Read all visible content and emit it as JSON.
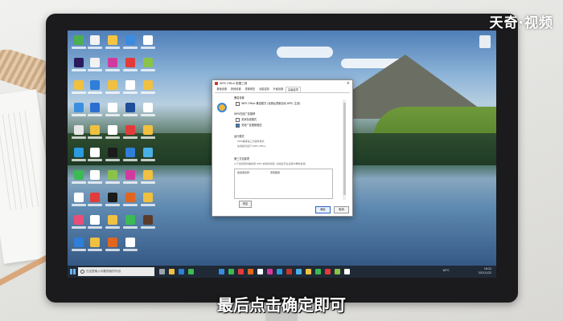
{
  "watermark": "天奇·视频",
  "subtitle": "最后点击确定即可",
  "dialog": {
    "title": "WPS Office 配置工具",
    "close_icon": "close-icon",
    "tabs": [
      "基础设置",
      "其他设置",
      "重置修复",
      "功能定制",
      "升级设置",
      "高级选项"
    ],
    "active_tab": "高级选项",
    "sections": {
      "compat_title": "兼容设置",
      "compat_option": "WPS Office 兼容模式 (设置后重新启动 WPS, 生效)",
      "wps_title": "WPS在线广告推荐",
      "wps_opt1": "关闭在线模式",
      "wps_opt2": "关闭广告更新推送",
      "office_title": "运行模式",
      "office_opt1": "WPS兼容第三方插件模式",
      "office_opt2": "在线模式运行 WPS Office",
      "plugin_title": "第三方加载项",
      "plugin_desc": "以下加载项将被禁用 WPS 启动时加载, 勾选后可在设置中重新启用。",
      "col1": "加载项名称",
      "col2": "安装路径"
    },
    "buttons": {
      "restore": "恢复",
      "ok": "确定",
      "cancel": "取消"
    }
  },
  "taskbar": {
    "search_placeholder": "在这里输入你要搜索的内容",
    "weather": "16°C",
    "time": "16:22",
    "date": "2021/1/22"
  }
}
